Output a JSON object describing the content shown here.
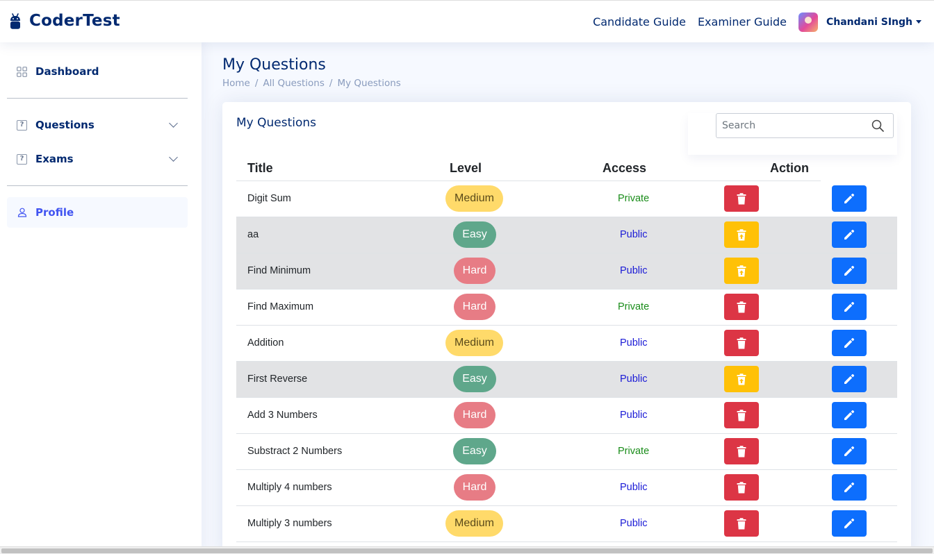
{
  "header": {
    "brand": "CoderTest",
    "links": [
      "Candidate Guide",
      "Examiner Guide"
    ],
    "user_name": "Chandani SIngh"
  },
  "sidebar": {
    "items": [
      {
        "label": "Dashboard",
        "icon": "grid-icon"
      },
      {
        "label": "Questions",
        "icon": "question-box-icon",
        "expandable": true
      },
      {
        "label": "Exams",
        "icon": "question-box-icon",
        "expandable": true
      },
      {
        "label": "Profile",
        "icon": "person-icon",
        "active": true
      }
    ]
  },
  "page": {
    "title": "My Questions",
    "breadcrumb": [
      "Home",
      "All Questions",
      "My Questions"
    ]
  },
  "card": {
    "title": "My Questions",
    "search_placeholder": "Search",
    "search_value": ""
  },
  "table": {
    "headers": [
      "Title",
      "Level",
      "Access",
      "Action"
    ],
    "rows": [
      {
        "title": "Digit Sum",
        "level": "Medium",
        "access": "Private",
        "action": "delete",
        "shaded": false
      },
      {
        "title": "aa",
        "level": "Easy",
        "access": "Public",
        "action": "restore",
        "shaded": true
      },
      {
        "title": "Find Minimum",
        "level": "Hard",
        "access": "Public",
        "action": "restore",
        "shaded": true
      },
      {
        "title": "Find Maximum",
        "level": "Hard",
        "access": "Private",
        "action": "delete",
        "shaded": false
      },
      {
        "title": "Addition",
        "level": "Medium",
        "access": "Public",
        "action": "delete",
        "shaded": false
      },
      {
        "title": "First Reverse",
        "level": "Easy",
        "access": "Public",
        "action": "restore",
        "shaded": true
      },
      {
        "title": "Add 3 Numbers",
        "level": "Hard",
        "access": "Public",
        "action": "delete",
        "shaded": false
      },
      {
        "title": "Substract 2 Numbers",
        "level": "Easy",
        "access": "Private",
        "action": "delete",
        "shaded": false
      },
      {
        "title": "Multiply 4 numbers",
        "level": "Hard",
        "access": "Public",
        "action": "delete",
        "shaded": false
      },
      {
        "title": "Multiply 3 numbers",
        "level": "Medium",
        "access": "Public",
        "action": "delete",
        "shaded": false
      }
    ]
  },
  "colors": {
    "brand": "#012970",
    "medium": "#ffda6a",
    "easy": "#5fa78b",
    "hard": "#e77c85",
    "private": "#198c19",
    "public": "#1a1ad6",
    "delete": "#dc3545",
    "restore": "#ffc107",
    "edit": "#0d6efd"
  }
}
